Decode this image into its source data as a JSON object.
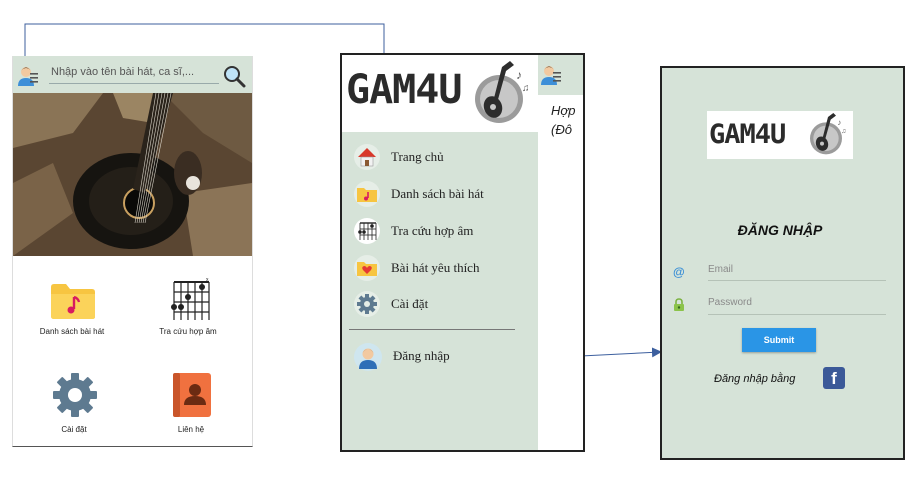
{
  "screen_home": {
    "search_placeholder": "Nhập vào tên bài hát, ca sĩ,...",
    "tiles": [
      {
        "label": "Danh sách bài hát",
        "icon": "music-folder-icon"
      },
      {
        "label": "Tra cứu hợp âm",
        "icon": "chord-chart-icon"
      },
      {
        "label": "Cài đặt",
        "icon": "gear-icon"
      },
      {
        "label": "Liên hệ",
        "icon": "contact-book-icon"
      }
    ]
  },
  "screen_drawer": {
    "logo_text": "GAM4U",
    "menu": [
      {
        "label": "Trang chủ",
        "icon": "home-icon"
      },
      {
        "label": "Danh sách bài hát",
        "icon": "music-folder-icon"
      },
      {
        "label": "Tra cứu hợp âm",
        "icon": "chord-chart-icon"
      },
      {
        "label": "Bài hát yêu thích",
        "icon": "heart-folder-icon"
      },
      {
        "label": "Cài đặt",
        "icon": "gear-icon"
      }
    ],
    "login_item": {
      "label": "Đăng nhập",
      "icon": "user-avatar-icon"
    },
    "peek_lines": [
      "Hợp",
      "(Đô"
    ]
  },
  "screen_login": {
    "logo_text": "GAM4U",
    "title": "ĐĂNG NHẬP",
    "email_placeholder": "Email",
    "password_placeholder": "Password",
    "email_icon": "@",
    "submit_label": "Submit",
    "facebook_login_text": "Đăng nhập bằng",
    "facebook_icon_glyph": "f"
  },
  "colors": {
    "panel_green": "#d6e3d8",
    "submit_blue": "#2a95e6",
    "facebook_blue": "#3b5998",
    "arrow_blue": "#3c5f9e"
  }
}
